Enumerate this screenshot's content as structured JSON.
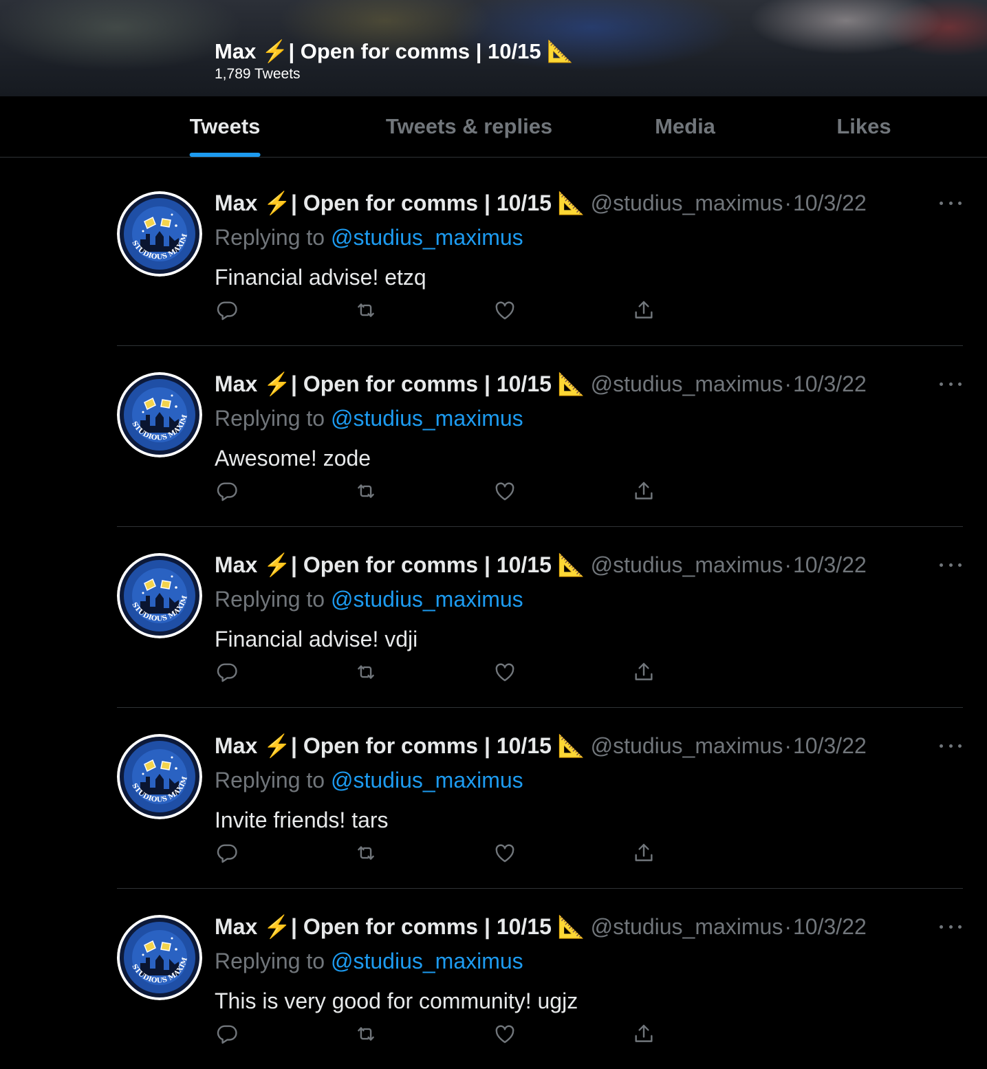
{
  "header": {
    "display_name": "Max ⚡️| Open for comms | 10/15 📐",
    "tweet_count": "1,789 Tweets"
  },
  "tabs": [
    {
      "label": "Tweets",
      "active": true
    },
    {
      "label": "Tweets & replies",
      "active": false
    },
    {
      "label": "Media",
      "active": false
    },
    {
      "label": "Likes",
      "active": false
    }
  ],
  "avatar": {
    "caption": "STUDIOUS MAXIMUS"
  },
  "tweets": [
    {
      "display_name": "Max ⚡️| Open for comms | 10/15 📐",
      "handle": "@studius_maximus",
      "separator": "·",
      "date": "10/3/22",
      "replying_prefix": "Replying to",
      "replying_to": "@studius_maximus",
      "text": "Financial advise! etzq"
    },
    {
      "display_name": "Max ⚡️| Open for comms | 10/15 📐",
      "handle": "@studius_maximus",
      "separator": "·",
      "date": "10/3/22",
      "replying_prefix": "Replying to",
      "replying_to": "@studius_maximus",
      "text": "Awesome! zode"
    },
    {
      "display_name": "Max ⚡️| Open for comms | 10/15 📐",
      "handle": "@studius_maximus",
      "separator": "·",
      "date": "10/3/22",
      "replying_prefix": "Replying to",
      "replying_to": "@studius_maximus",
      "text": "Financial advise! vdji"
    },
    {
      "display_name": "Max ⚡️| Open for comms | 10/15 📐",
      "handle": "@studius_maximus",
      "separator": "·",
      "date": "10/3/22",
      "replying_prefix": "Replying to",
      "replying_to": "@studius_maximus",
      "text": "Invite friends! tars"
    },
    {
      "display_name": "Max ⚡️| Open for comms | 10/15 📐",
      "handle": "@studius_maximus",
      "separator": "·",
      "date": "10/3/22",
      "replying_prefix": "Replying to",
      "replying_to": "@studius_maximus",
      "text": "This is very good for community! ugjz"
    }
  ],
  "icons": {
    "reply": "reply-icon",
    "retweet": "retweet-icon",
    "like": "heart-icon",
    "share": "share-icon",
    "more": "more-icon"
  },
  "colors": {
    "background": "#000000",
    "accent": "#1d9bf0",
    "text_primary": "#e7e9ea",
    "text_secondary": "#71767b",
    "divider": "#2f3336"
  }
}
